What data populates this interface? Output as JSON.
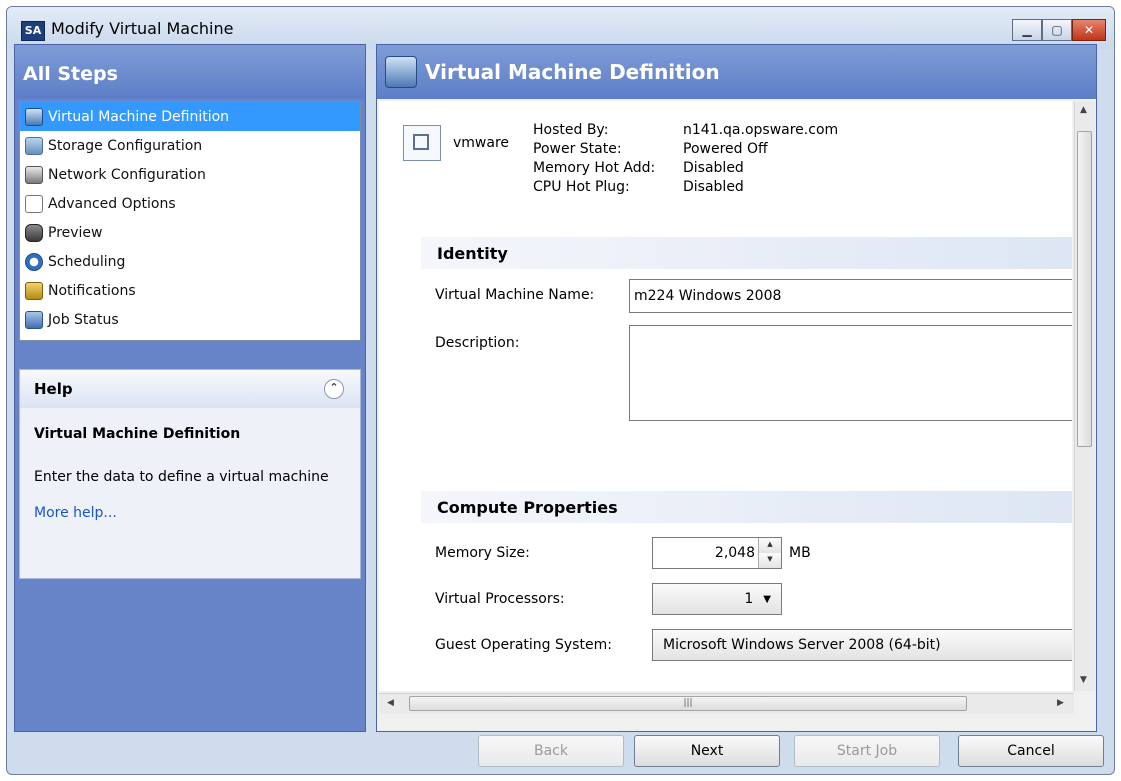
{
  "window": {
    "title": "Modify Virtual Machine",
    "app_icon_text": "SA"
  },
  "steps": {
    "header": "All Steps",
    "items": [
      {
        "label": "Virtual Machine Definition",
        "icon": "vm-definition-icon",
        "active": true
      },
      {
        "label": "Storage Configuration",
        "icon": "storage-icon"
      },
      {
        "label": "Network Configuration",
        "icon": "network-icon"
      },
      {
        "label": "Advanced Options",
        "icon": "advanced-options-icon"
      },
      {
        "label": "Preview",
        "icon": "preview-binoculars-icon"
      },
      {
        "label": "Scheduling",
        "icon": "clock-icon"
      },
      {
        "label": "Notifications",
        "icon": "notification-icon"
      },
      {
        "label": "Job Status",
        "icon": "job-status-icon"
      }
    ]
  },
  "help": {
    "header": "Help",
    "title": "Virtual Machine Definition",
    "text": "Enter the data to define a virtual machine",
    "link": "More help..."
  },
  "main": {
    "header": "Virtual Machine Definition",
    "vendor": "vmware",
    "info": {
      "hosted_by_label": "Hosted By:",
      "hosted_by_value": "n141.qa.opsware.com",
      "power_state_label": "Power State:",
      "power_state_value": "Powered Off",
      "memory_hot_add_label": "Memory Hot Add:",
      "memory_hot_add_value": "Disabled",
      "cpu_hot_plug_label": "CPU Hot Plug:",
      "cpu_hot_plug_value": "Disabled"
    },
    "identity": {
      "section": "Identity",
      "name_label": "Virtual Machine Name:",
      "name_value": "m224 Windows 2008",
      "description_label": "Description:",
      "description_value": ""
    },
    "compute": {
      "section": "Compute Properties",
      "memory_label": "Memory Size:",
      "memory_value": "2,048",
      "memory_unit": "MB",
      "processors_label": "Virtual Processors:",
      "processors_value": "1",
      "os_label": "Guest Operating System:",
      "os_value": "Microsoft Windows Server 2008 (64-bit)"
    }
  },
  "buttons": {
    "back": "Back",
    "next": "Next",
    "start_job": "Start Job",
    "cancel": "Cancel"
  },
  "colors": {
    "accent_header": "#5d7ec8",
    "selection": "#3399ff",
    "link": "#1a55c7"
  }
}
